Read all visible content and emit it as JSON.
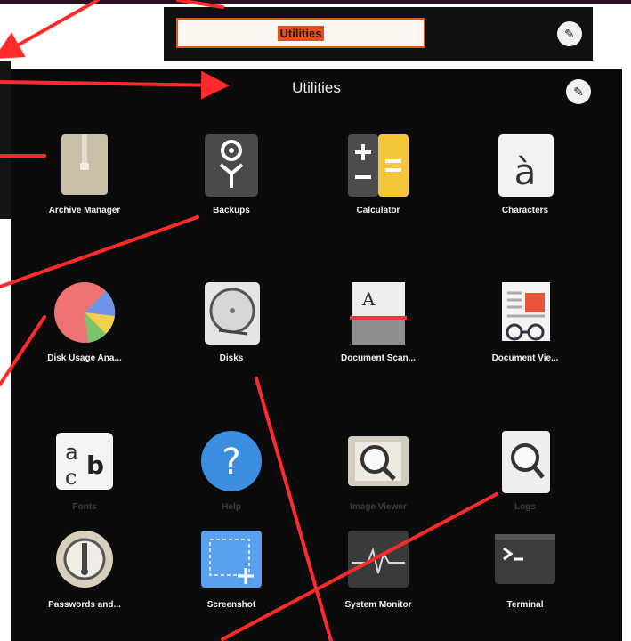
{
  "rename_bar": {
    "value": "Utilities",
    "edit_icon": "pencil-icon"
  },
  "folder": {
    "title": "Utilities",
    "edit_icon": "pencil-icon",
    "apps": [
      {
        "label": "Archive Manager",
        "icon": "archive-manager-icon"
      },
      {
        "label": "Backups",
        "icon": "backups-icon"
      },
      {
        "label": "Calculator",
        "icon": "calculator-icon"
      },
      {
        "label": "Characters",
        "icon": "characters-icon"
      },
      {
        "label": "Disk Usage Ana...",
        "icon": "disk-usage-analyzer-icon"
      },
      {
        "label": "Disks",
        "icon": "disks-icon"
      },
      {
        "label": "Document Scan...",
        "icon": "document-scanner-icon"
      },
      {
        "label": "Document Vie...",
        "icon": "document-viewer-icon"
      },
      {
        "label": "Fonts",
        "icon": "fonts-icon"
      },
      {
        "label": "Help",
        "icon": "help-icon"
      },
      {
        "label": "Image Viewer",
        "icon": "image-viewer-icon"
      },
      {
        "label": "Logs",
        "icon": "logs-icon"
      },
      {
        "label": "Passwords and...",
        "icon": "passwords-keys-icon"
      },
      {
        "label": "Screenshot",
        "icon": "screenshot-icon"
      },
      {
        "label": "System Monitor",
        "icon": "system-monitor-icon"
      },
      {
        "label": "Terminal",
        "icon": "terminal-icon"
      }
    ]
  },
  "colors": {
    "annotation": "#ff2a2a",
    "background": "#0b0b0b"
  }
}
